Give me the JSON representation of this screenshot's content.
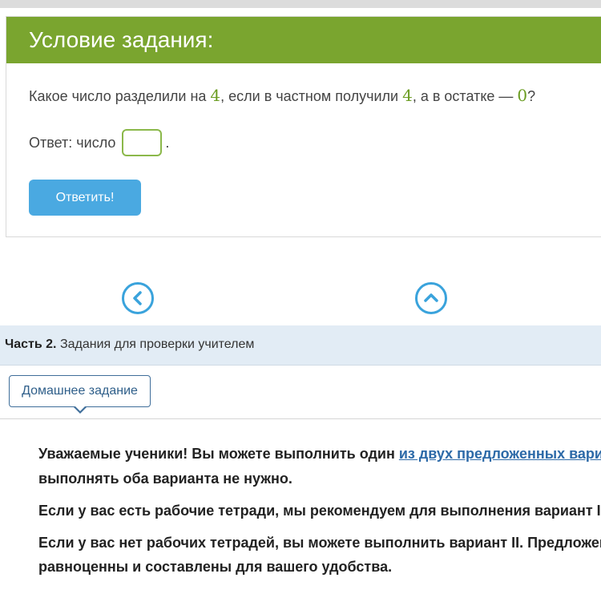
{
  "task_card": {
    "title": "Условие задания:",
    "question": {
      "part1": "Какое число разделили на ",
      "divisor": "4",
      "part2": ", если в частном получили ",
      "quotient": "4",
      "part3": ", а в остатке — ",
      "remainder": "0",
      "part4": "?"
    },
    "answer": {
      "label": "Ответ: число",
      "value": "",
      "suffix": "."
    },
    "submit_label": "Ответить!"
  },
  "navigation": {
    "prev_icon": "chevron-left-icon",
    "top_icon": "chevron-up-icon"
  },
  "part2": {
    "title_bold": "Часть 2.",
    "title_rest": " Задания для проверки учителем"
  },
  "homework_tab": {
    "label": "Домашнее задание"
  },
  "content": {
    "p1_start": "Уважаемые ученики! Вы можете выполнить один ",
    "p1_link": "из двух предложенных вари",
    "p1_line2": "выполнять оба варианта не нужно.",
    "p2": "Если у вас есть рабочие тетради, мы рекомендуем для выполнения вариант I д",
    "p3_line1": "Если у вас нет рабочих тетрадей, вы можете выполнить вариант II. Предложен",
    "p3_line2": "равноценны и составлены для вашего удобства."
  },
  "colors": {
    "header_green": "#7aa52f",
    "accent_blue": "#4aa9e1",
    "part_bar": "#e2ecf5",
    "link": "#2d6aa8"
  }
}
